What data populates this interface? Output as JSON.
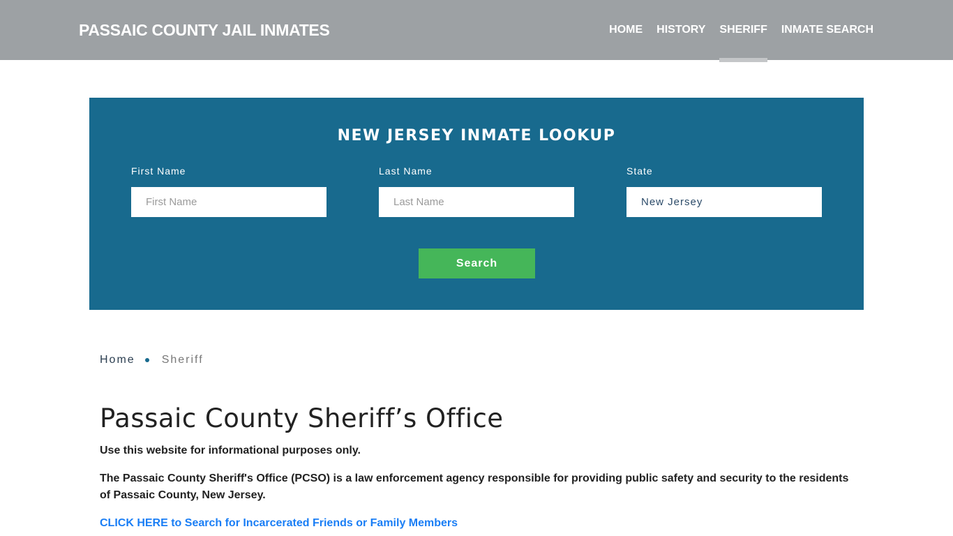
{
  "header": {
    "brand": "PASSAIC COUNTY JAIL INMATES",
    "nav": [
      {
        "label": "HOME",
        "active": false
      },
      {
        "label": "HISTORY",
        "active": false
      },
      {
        "label": "SHERIFF",
        "active": true
      },
      {
        "label": "INMATE SEARCH",
        "active": false
      }
    ]
  },
  "lookup": {
    "title": "NEW JERSEY INMATE LOOKUP",
    "first_name": {
      "label": "First Name",
      "placeholder": "First Name",
      "value": ""
    },
    "last_name": {
      "label": "Last Name",
      "placeholder": "Last Name",
      "value": ""
    },
    "state": {
      "label": "State",
      "value": "New Jersey"
    },
    "search_label": "Search"
  },
  "breadcrumb": {
    "home": "Home",
    "current": "Sheriff"
  },
  "main": {
    "title": "Passaic County Sheriff’s Office",
    "disclaimer": "Use this website for informational purposes only.",
    "description": "The Passaic County Sheriff's Office (PCSO) is a law enforcement agency responsible for providing public safety and security to the residents of Passaic County, New Jersey.",
    "cta": "CLICK HERE to Search for Incarcerated Friends or Family Members"
  },
  "colors": {
    "header_bg": "#9da1a4",
    "lookup_bg": "#186a8e",
    "button_green": "#45b659",
    "link_blue": "#1a7ef5"
  }
}
